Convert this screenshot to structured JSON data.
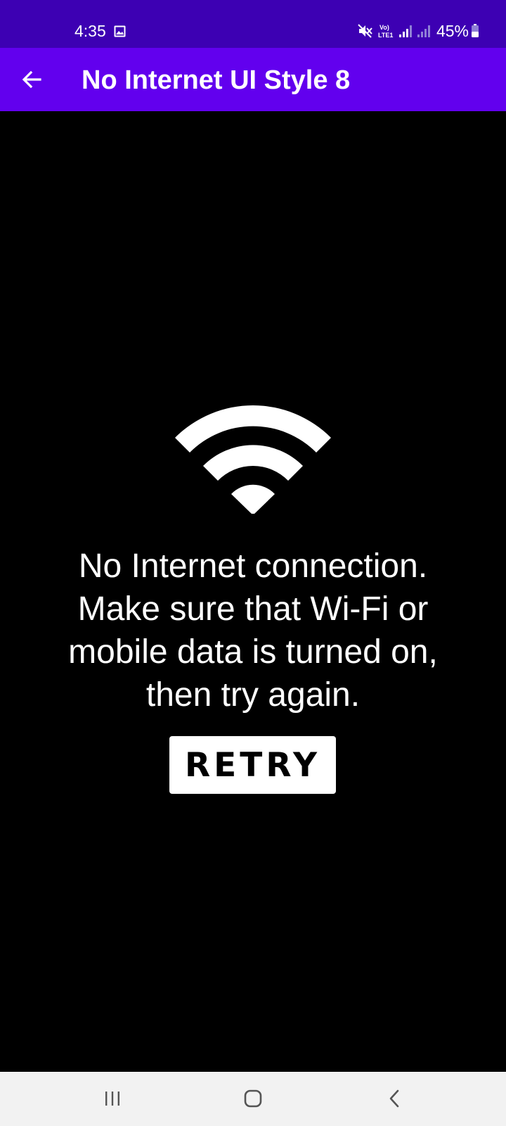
{
  "status_bar": {
    "time": "4:35",
    "battery": "45%",
    "icons": [
      "gallery-icon",
      "mute-icon",
      "volte-icon",
      "signal-icon",
      "signal-icon",
      "battery-icon"
    ],
    "background_color": "#3d00b3"
  },
  "app_bar": {
    "title": "No Internet UI Style 8",
    "back_icon": "arrow-left-icon",
    "background_color": "#6200ee"
  },
  "main": {
    "icon": "wifi-icon",
    "message_lines": [
      "No Internet connection.",
      "Make sure that Wi-Fi or",
      "mobile data is turned on,",
      "then try again."
    ],
    "retry_label": "RETRY",
    "background_color": "#000000"
  },
  "nav_bar": {
    "buttons": [
      "recents-icon",
      "home-icon",
      "back-icon"
    ],
    "background_color": "#f2f2f2"
  }
}
